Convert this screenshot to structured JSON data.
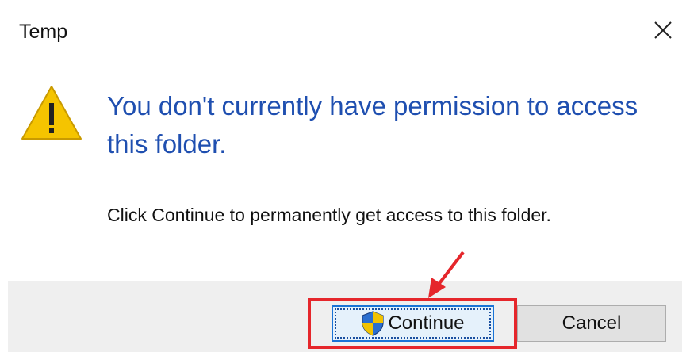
{
  "window": {
    "title": "Temp"
  },
  "message": {
    "main_instruction": "You don't currently have permission to access this folder.",
    "content": "Click Continue to permanently get access to this folder."
  },
  "buttons": {
    "continue_label": "Continue",
    "cancel_label": "Cancel"
  },
  "icons": {
    "warning": "warning-icon",
    "shield": "uac-shield-icon",
    "close": "close-icon"
  },
  "colors": {
    "main_instruction": "#1f4fb0",
    "highlight": "#e5262b",
    "warning": "#f5c400"
  }
}
